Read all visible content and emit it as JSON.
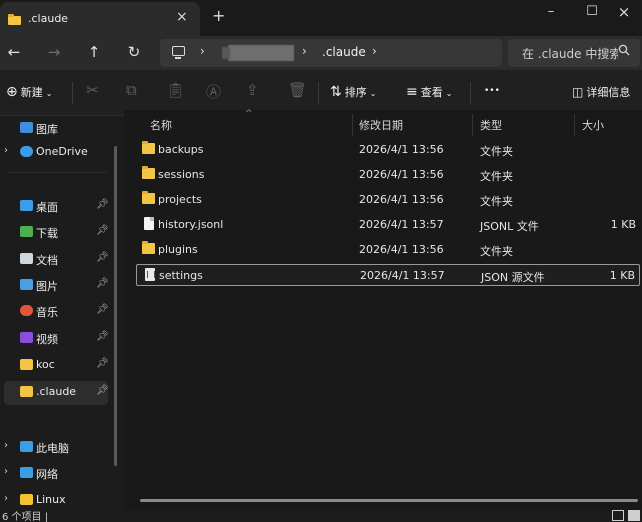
{
  "tab": {
    "title": ".claude",
    "close": "×",
    "new": "+"
  },
  "window": {
    "minimize": "–",
    "maximize": "☐",
    "close": "×"
  },
  "nav": {
    "back": "←",
    "forward": "→",
    "up": "↑",
    "refresh": "↻"
  },
  "address": {
    "sep1": "›",
    "sep2": "›",
    "current": ".claude",
    "sep3": "›"
  },
  "search": {
    "placeholder": "在 .claude 中搜索",
    "icon": "search-icon"
  },
  "commands": {
    "new_label": "新建",
    "sort_label": "排序",
    "view_label": "查看",
    "more_label": "•••",
    "details_label": "详细信息"
  },
  "sidebar": {
    "items": [
      {
        "label": "图库",
        "icon": "gallery-icon",
        "color": "#3f8fdc",
        "expand": ""
      },
      {
        "label": "OneDrive",
        "icon": "cloud-icon",
        "color": "#3b9de8",
        "expand": "›"
      },
      {
        "label": "桌面",
        "icon": "desktop-icon",
        "color": "#3b9de8",
        "pin": true
      },
      {
        "label": "下载",
        "icon": "download-icon",
        "color": "#4caf50",
        "pin": true
      },
      {
        "label": "文档",
        "icon": "documents-icon",
        "color": "#cfd6e0",
        "pin": true
      },
      {
        "label": "图片",
        "icon": "pictures-icon",
        "color": "#4aa0e6",
        "pin": true
      },
      {
        "label": "音乐",
        "icon": "music-icon",
        "color": "#e2563e",
        "pin": true
      },
      {
        "label": "视频",
        "icon": "video-icon",
        "color": "#8a4fd8",
        "pin": true
      },
      {
        "label": "koc",
        "icon": "folder-icon",
        "color": "#f3c544",
        "pin": true
      },
      {
        "label": ".claude",
        "icon": "folder-icon",
        "color": "#f3c544",
        "pin": true,
        "selected": true
      },
      {
        "label": "此电脑",
        "icon": "this-pc-icon",
        "color": "#3b9de8",
        "expand": "›"
      },
      {
        "label": "网络",
        "icon": "network-icon",
        "color": "#3b9de8",
        "expand": "›"
      },
      {
        "label": "Linux",
        "icon": "linux-icon",
        "color": "#f1c232",
        "expand": "›"
      }
    ]
  },
  "columns": {
    "name": "名称",
    "modified": "修改日期",
    "type": "类型",
    "size": "大小"
  },
  "files": [
    {
      "name": "backups",
      "modified": "2026/4/1 13:56",
      "type": "文件夹",
      "size": "",
      "kind": "folder"
    },
    {
      "name": "sessions",
      "modified": "2026/4/1 13:56",
      "type": "文件夹",
      "size": "",
      "kind": "folder"
    },
    {
      "name": "projects",
      "modified": "2026/4/1 13:56",
      "type": "文件夹",
      "size": "",
      "kind": "folder"
    },
    {
      "name": "history.jsonl",
      "modified": "2026/4/1 13:57",
      "type": "JSONL 文件",
      "size": "1 KB",
      "kind": "file"
    },
    {
      "name": "plugins",
      "modified": "2026/4/1 13:56",
      "type": "文件夹",
      "size": "",
      "kind": "folder"
    },
    {
      "name": "settings",
      "modified": "2026/4/1 13:57",
      "type": "JSON 源文件",
      "size": "1 KB",
      "kind": "json",
      "selected": true
    }
  ],
  "status": {
    "text": "6 个项目  |"
  }
}
